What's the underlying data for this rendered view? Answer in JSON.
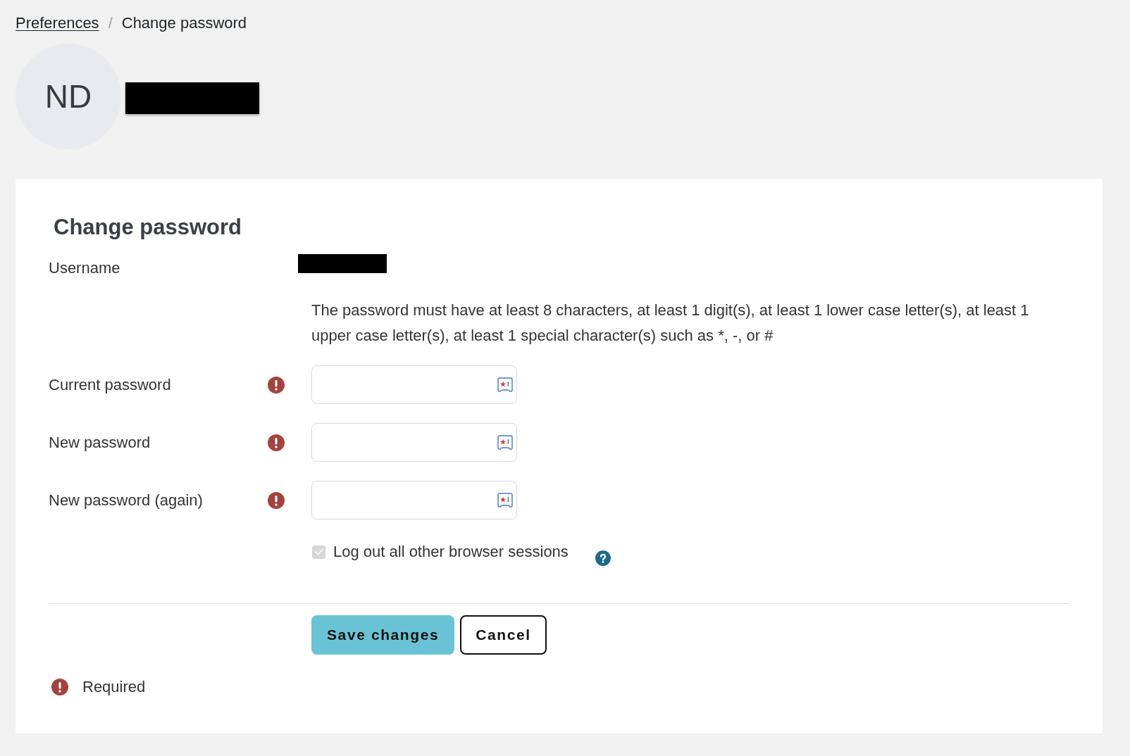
{
  "breadcrumb": {
    "items": [
      {
        "label": "Preferences",
        "kind": "link"
      },
      {
        "label": "Change password",
        "kind": "current"
      }
    ],
    "separator": "/"
  },
  "profile": {
    "initials": "ND"
  },
  "form": {
    "title": "Change password",
    "username_label": "Username",
    "password_rules": "The password must have at least 8 characters, at least 1 digit(s), at least 1 lower case letter(s), at least 1 upper case letter(s), at least 1 special character(s) such as *, -, or #",
    "fields": [
      {
        "label": "Current password",
        "required": true
      },
      {
        "label": "New password",
        "required": true
      },
      {
        "label": "New password (again)",
        "required": true
      }
    ],
    "logout_option": {
      "label": "Log out all other browser sessions",
      "checked": true,
      "disabled": true
    },
    "buttons": [
      {
        "label": "Save changes",
        "kind": "primary"
      },
      {
        "label": "Cancel",
        "kind": "secondary"
      }
    ],
    "required_note": "Required"
  }
}
